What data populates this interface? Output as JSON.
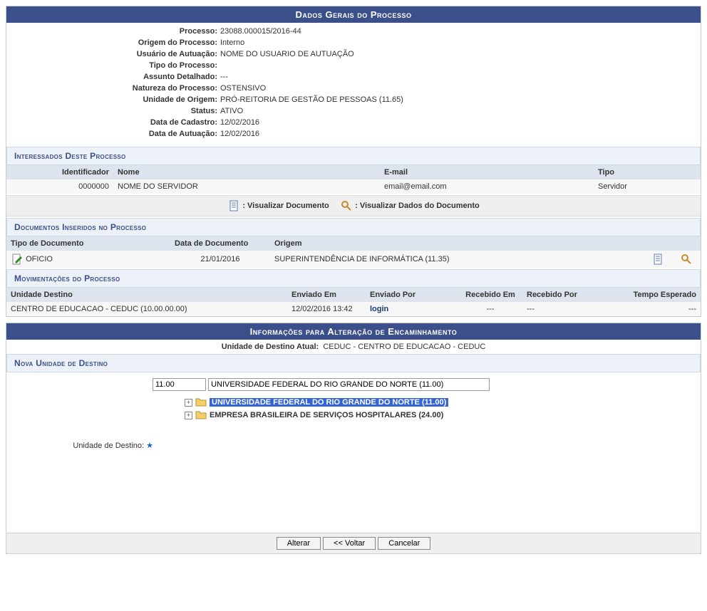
{
  "panel1_title": "Dados Gerais do Processo",
  "fields": {
    "processo": {
      "label": "Processo:",
      "value": "23088.000015/2016-44"
    },
    "origem": {
      "label": "Origem do Processo:",
      "value": "Interno"
    },
    "usuario_autuacao": {
      "label": "Usuário de Autuação:",
      "value": "NOME DO USUARIO DE AUTUAÇÃO"
    },
    "tipo_processo": {
      "label": "Tipo do Processo:",
      "value": ""
    },
    "assunto": {
      "label": "Assunto Detalhado:",
      "value": "---"
    },
    "natureza": {
      "label": "Natureza do Processo:",
      "value": "OSTENSIVO"
    },
    "unidade_origem": {
      "label": "Unidade de Origem:",
      "value": "PRÓ-REITORIA DE GESTÃO DE PESSOAS (11.65)"
    },
    "status": {
      "label": "Status:",
      "value": "ATIVO"
    },
    "data_cadastro": {
      "label": "Data de Cadastro:",
      "value": "12/02/2016"
    },
    "data_autuacao": {
      "label": "Data de Autuação:",
      "value": "12/02/2016"
    }
  },
  "interessados": {
    "header": "Interessados Deste Processo",
    "cols": [
      "Identificador",
      "Nome",
      "E-mail",
      "Tipo"
    ],
    "rows": [
      {
        "id": "0000000",
        "nome": "NOME DO SERVIDOR",
        "email": "email@email.com",
        "tipo": "Servidor"
      }
    ]
  },
  "toolbar": {
    "visualizar_doc": ": Visualizar Documento",
    "visualizar_dados": ": Visualizar Dados do Documento"
  },
  "documentos": {
    "header": "Documentos Inseridos no Processo",
    "cols": [
      "Tipo de Documento",
      "Data de Documento",
      "Origem"
    ],
    "rows": [
      {
        "tipo": "OFICIO",
        "data": "21/01/2016",
        "origem": "SUPERINTENDÊNCIA DE INFORMÁTICA (11.35)"
      }
    ]
  },
  "movimentacoes": {
    "header": "Movimentações do Processo",
    "cols": [
      "Unidade Destino",
      "Enviado Em",
      "Enviado Por",
      "Recebido Em",
      "Recebido Por",
      "Tempo Esperado"
    ],
    "rows": [
      {
        "unidade": "CENTRO DE EDUCACAO - CEDUC (10.00.00.00)",
        "env_em": "12/02/2016 13:42",
        "env_por": "login",
        "rec_em": "---",
        "rec_por": "---",
        "tempo": "---"
      }
    ]
  },
  "panel2_title": "Informações para Alteração de Encaminhamento",
  "unidade_atual": {
    "label": "Unidade de Destino Atual:",
    "value": "CEDUC - CENTRO DE EDUCACAO - CEDUC"
  },
  "nova_unidade_header": "Nova Unidade de Destino",
  "search": {
    "code": "11.00",
    "name": "UNIVERSIDADE FEDERAL DO RIO GRANDE DO NORTE (11.00)"
  },
  "tree": [
    {
      "label": "UNIVERSIDADE FEDERAL DO RIO GRANDE DO NORTE (11.00)",
      "selected": true
    },
    {
      "label": "EMPRESA BRASILEIRA DE SERVIÇOS HOSPITALARES (24.00)",
      "selected": false
    }
  ],
  "destino_label": "Unidade de Destino:",
  "buttons": {
    "alterar": "Alterar",
    "voltar": "<< Voltar",
    "cancelar": "Cancelar"
  }
}
